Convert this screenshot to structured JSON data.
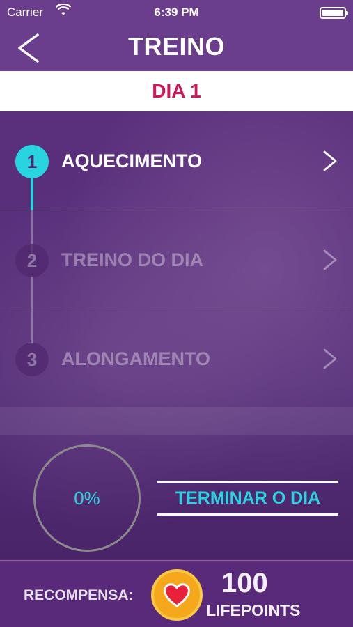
{
  "status_bar": {
    "carrier": "Carrier",
    "time": "6:39 PM"
  },
  "nav": {
    "title": "TREINO",
    "back_icon": "chevron-left-icon"
  },
  "day": {
    "label": "DIA 1"
  },
  "steps": [
    {
      "number": "1",
      "label": "AQUECIMENTO",
      "state": "active"
    },
    {
      "number": "2",
      "label": "TREINO DO DIA",
      "state": "inactive"
    },
    {
      "number": "3",
      "label": "ALONGAMENTO",
      "state": "inactive"
    }
  ],
  "progress": {
    "value": "0%",
    "fraction": 0
  },
  "actions": {
    "finish_label": "TERMINAR O DIA"
  },
  "reward": {
    "label": "RECOMPENSA:",
    "points": "100",
    "unit": "LIFEPOINTS",
    "icon": "heart-icon"
  },
  "colors": {
    "accent": "#28d4e0",
    "day_label": "#d4145a",
    "badge": "#f5a81c",
    "heart": "#e8203a"
  }
}
